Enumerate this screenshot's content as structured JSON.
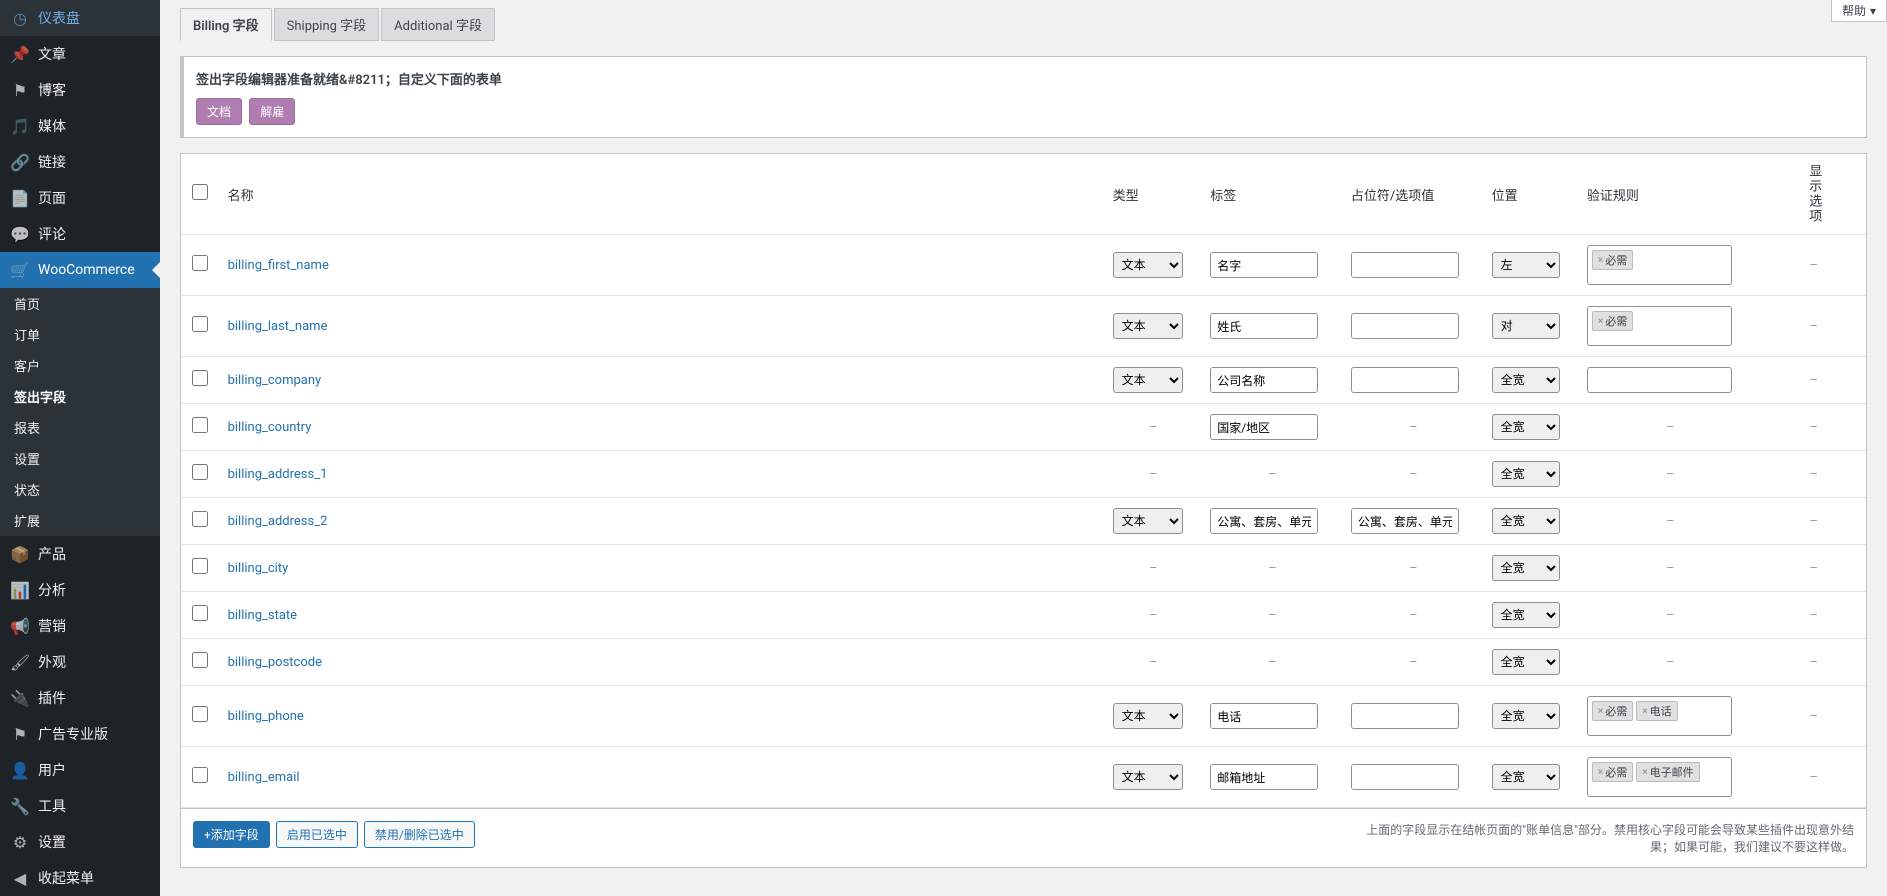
{
  "help": "帮助",
  "sidebar": {
    "items": [
      {
        "icon": "◷",
        "label": "仪表盘"
      },
      {
        "icon": "📌",
        "label": "文章"
      },
      {
        "icon": "⚑",
        "label": "博客"
      },
      {
        "icon": "🎵",
        "label": "媒体"
      },
      {
        "icon": "🔗",
        "label": "链接"
      },
      {
        "icon": "📄",
        "label": "页面"
      },
      {
        "icon": "💬",
        "label": "评论"
      },
      {
        "icon": "🛒",
        "label": "WooCommerce",
        "active": true,
        "submenu": [
          {
            "label": "首页"
          },
          {
            "label": "订单"
          },
          {
            "label": "客户"
          },
          {
            "label": "签出字段",
            "current": true
          },
          {
            "label": "报表"
          },
          {
            "label": "设置"
          },
          {
            "label": "状态"
          },
          {
            "label": "扩展"
          }
        ]
      },
      {
        "icon": "📦",
        "label": "产品"
      },
      {
        "icon": "📊",
        "label": "分析"
      },
      {
        "icon": "📢",
        "label": "营销"
      },
      {
        "icon": "🖌",
        "label": "外观"
      },
      {
        "icon": "🔌",
        "label": "插件"
      },
      {
        "icon": "⚑",
        "label": "广告专业版"
      },
      {
        "icon": "👤",
        "label": "用户"
      },
      {
        "icon": "🔧",
        "label": "工具"
      },
      {
        "icon": "⚙",
        "label": "设置"
      },
      {
        "icon": "◀",
        "label": "收起菜单"
      }
    ]
  },
  "tabs": [
    {
      "label": "Billing 字段",
      "active": true
    },
    {
      "label": "Shipping 字段"
    },
    {
      "label": "Additional 字段"
    }
  ],
  "notice": {
    "text": "签出字段编辑器准备就绪&#8211；自定义下面的表单",
    "btn1": "文档",
    "btn2": "解雇"
  },
  "headers": {
    "name": "名称",
    "type": "类型",
    "label": "标签",
    "placeholder": "占位符/选项值",
    "position": "位置",
    "validation": "验证规则",
    "show": "显示选项"
  },
  "rows": [
    {
      "name": "billing_first_name",
      "type": "文本",
      "label": "名字",
      "placeholder": "",
      "position": "左",
      "tags": [
        "必需"
      ],
      "tall": true
    },
    {
      "name": "billing_last_name",
      "type": "文本",
      "label": "姓氏",
      "placeholder": "",
      "position": "对",
      "tags": [
        "必需"
      ],
      "tall": true
    },
    {
      "name": "billing_company",
      "type": "文本",
      "label": "公司名称",
      "placeholder": "",
      "position": "全宽",
      "tags": [],
      "tall": false,
      "tagbox_empty": true
    },
    {
      "name": "billing_country",
      "type": "-",
      "label": "国家/地区",
      "placeholder": "-",
      "position": "全宽",
      "tags": "-"
    },
    {
      "name": "billing_address_1",
      "type": "-",
      "label": "-",
      "placeholder": "-",
      "position": "全宽",
      "tags": "-"
    },
    {
      "name": "billing_address_2",
      "type": "文本",
      "label": "公寓、套房、单元房",
      "placeholder": "公寓、套房、单元房",
      "position": "全宽",
      "tags": "-"
    },
    {
      "name": "billing_city",
      "type": "-",
      "label": "-",
      "placeholder": "-",
      "position": "全宽",
      "tags": "-"
    },
    {
      "name": "billing_state",
      "type": "-",
      "label": "-",
      "placeholder": "-",
      "position": "全宽",
      "tags": "-"
    },
    {
      "name": "billing_postcode",
      "type": "-",
      "label": "-",
      "placeholder": "-",
      "position": "全宽",
      "tags": "-"
    },
    {
      "name": "billing_phone",
      "type": "文本",
      "label": "电话",
      "placeholder": "",
      "position": "全宽",
      "tags": [
        "必需",
        "电话"
      ],
      "tall": true
    },
    {
      "name": "billing_email",
      "type": "文本",
      "label": "邮箱地址",
      "placeholder": "",
      "position": "全宽",
      "tags": [
        "必需",
        "电子邮件"
      ],
      "tall": true
    }
  ],
  "footer": {
    "add": "+添加字段",
    "enable": "启用已选中",
    "disable": "禁用/删除已选中",
    "note": "上面的字段显示在结帐页面的\"账单信息\"部分。禁用核心字段可能会导致某些插件出现意外结果；如果可能，我们建议不要这样做。"
  }
}
